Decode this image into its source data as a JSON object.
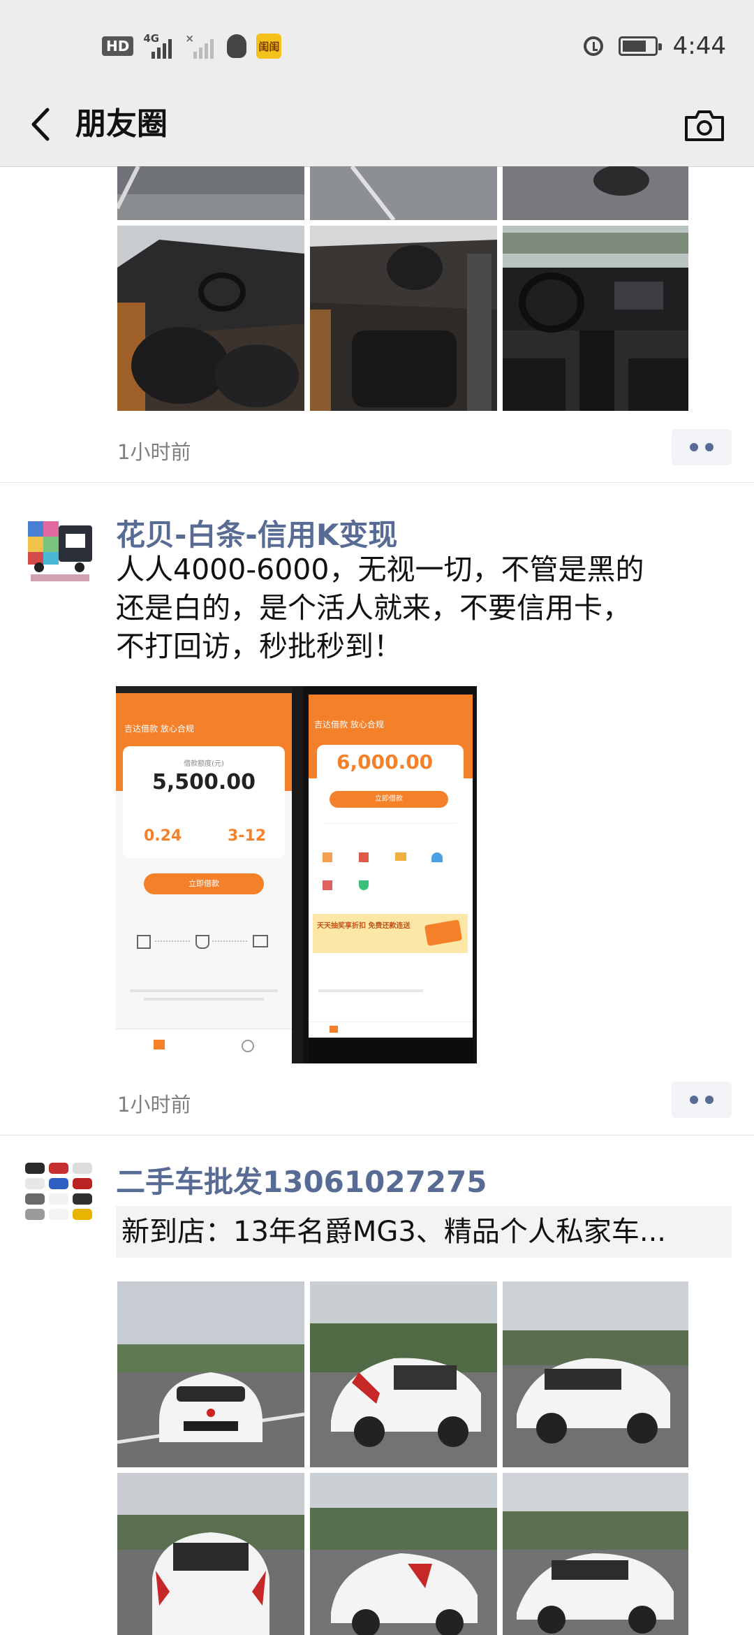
{
  "status_bar": {
    "hd_label": "HD",
    "network_label": "4G",
    "app_badge": "闺闺",
    "time": "4:44"
  },
  "nav": {
    "title": "朋友圈"
  },
  "posts": [
    {
      "time": "1小时前"
    },
    {
      "name": "花贝-白条-信用K变现",
      "text": "人人4000-6000，无视一切，不管是黑的\n还是白的，是个活人就来，不要信用卡，\n不打回访，秒批秒到！",
      "time": "1小时前",
      "screenshot_left": {
        "banner": "吉达借款 放心合规",
        "label": "借款额度(元)",
        "amount": "5,500.00",
        "rate": "0.24",
        "term": "3-12",
        "button": "立即借款"
      },
      "screenshot_right": {
        "banner": "吉达借款 放心合规",
        "amount": "6,000.00",
        "button": "立即借款",
        "promo": "天天抽奖享折扣 免费还款连送"
      }
    },
    {
      "name": "二手车批发13061027275",
      "share_text": "新到店：13年名爵MG3、精品个人私家车..."
    }
  ],
  "colors": {
    "nav_bg": "#ededed",
    "name_link": "#576b95",
    "time_text": "#7f7f7f",
    "share_bg": "#f3f3f5",
    "orange": "#f5802a"
  }
}
